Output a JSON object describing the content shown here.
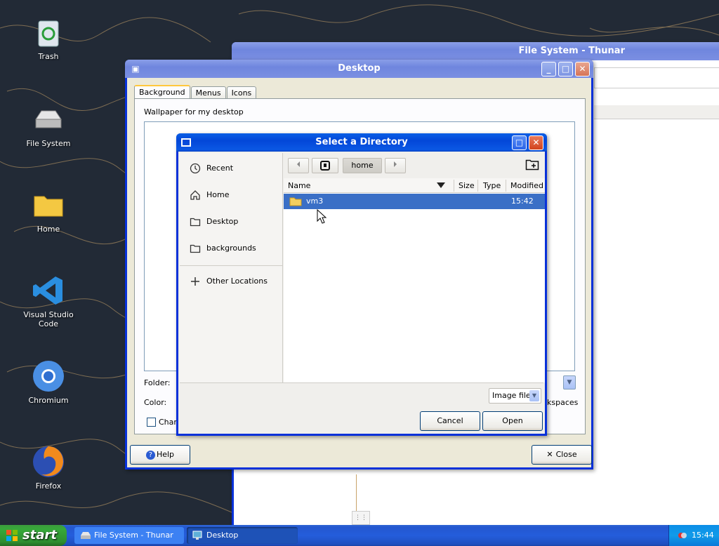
{
  "desktop": {
    "icons": [
      {
        "label": "Trash",
        "icon": "trash-icon"
      },
      {
        "label": "File System",
        "icon": "drive-icon"
      },
      {
        "label": "Home",
        "icon": "folder-icon"
      },
      {
        "label": "Visual Studio Code",
        "icon": "vscode-icon"
      },
      {
        "label": "Chromium",
        "icon": "chromium-icon"
      },
      {
        "label": "Firefox",
        "icon": "firefox-icon"
      }
    ]
  },
  "thunar": {
    "title": "File System - Thunar"
  },
  "desktop_settings": {
    "title": "Desktop",
    "tabs": [
      "Background",
      "Menus",
      "Icons"
    ],
    "wallpaper_label": "Wallpaper for my desktop",
    "folder_label": "Folder:",
    "color_label": "Color:",
    "change_label": "Chang",
    "workspaces_label": "kspaces",
    "help_label": "Help",
    "close_label": "Close"
  },
  "select_dir": {
    "title": "Select a Directory",
    "places": [
      {
        "label": "Recent",
        "icon": "recent-icon"
      },
      {
        "label": "Home",
        "icon": "home-icon"
      },
      {
        "label": "Desktop",
        "icon": "folder-icon"
      },
      {
        "label": "backgrounds",
        "icon": "folder-icon"
      }
    ],
    "other_locations": "Other Locations",
    "path_button": "home",
    "columns": {
      "name": "Name",
      "size": "Size",
      "type": "Type",
      "modified": "Modified"
    },
    "rows": [
      {
        "name": "vm3",
        "modified": "15:42"
      }
    ],
    "filter": "Image files",
    "cancel_label": "Cancel",
    "open_label": "Open"
  },
  "taskbar": {
    "start_label": "start",
    "tasks": [
      "File System - Thunar",
      "Desktop"
    ],
    "clock": "15:44"
  },
  "colors": {
    "accent": "#3a6fc6",
    "title_active": "#0347d8",
    "taskbar": "#245ddb"
  }
}
